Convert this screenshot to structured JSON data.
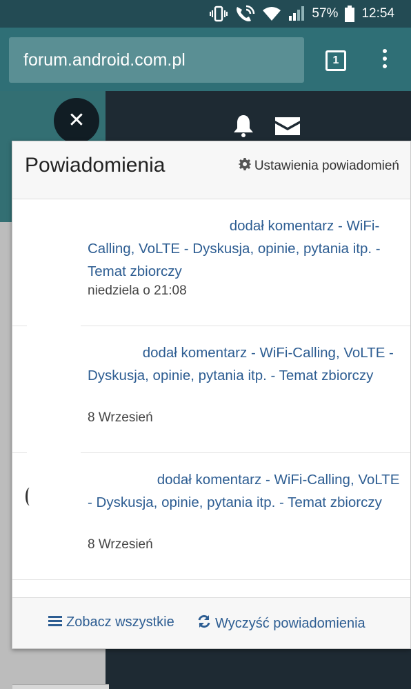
{
  "status_bar": {
    "battery": "57%",
    "time": "12:54"
  },
  "browser": {
    "url": "forum.android.com.pl",
    "tab_count": "1"
  },
  "page": {
    "close_symbol": "✕"
  },
  "notifications": {
    "title": "Powiadomienia",
    "settings_label": "Ustawienia powiadomień",
    "items": [
      {
        "text": "dodał komentarz - WiFi-Calling, VoLTE - Dyskusja, opinie, pytania itp. - Temat zbiorczy",
        "time": "niedziela o 21:08"
      },
      {
        "text": "dodał komentarz - WiFi-Calling, VoLTE - Dyskusja, opinie, pytania itp. - Temat zbiorczy",
        "time": "8 Wrzesień"
      },
      {
        "text": "dodał komentarz - WiFi-Calling, VoLTE - Dyskusja, opinie, pytania itp. - Temat zbiorczy",
        "time": "8 Wrzesień"
      }
    ],
    "footer": {
      "view_all": "Zobacz wszystkie",
      "clear_all": "Wyczyść powiadomienia"
    }
  },
  "colors": {
    "accent": "#2f6f76",
    "link": "#2d5d92",
    "statusbar": "#234b54"
  },
  "icons": [
    "vibrate-icon",
    "wifi-calling-icon",
    "wifi-icon",
    "signal-icon",
    "battery-icon",
    "bell-icon",
    "envelope-icon",
    "gear-icon",
    "list-icon",
    "refresh-icon"
  ]
}
